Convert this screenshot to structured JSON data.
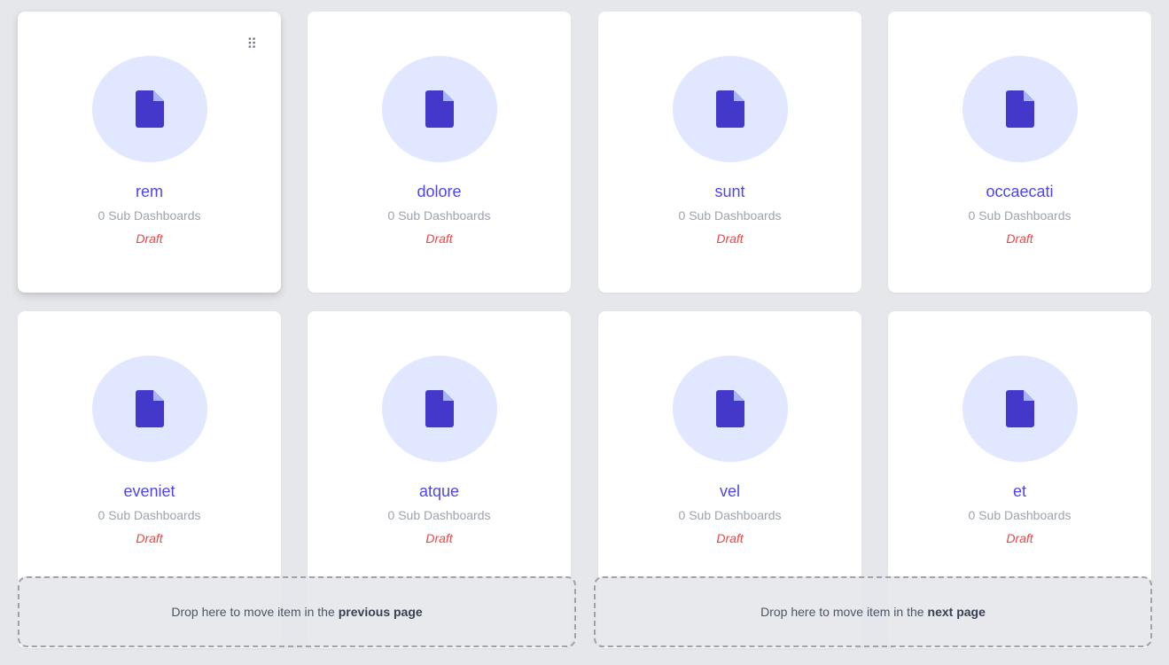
{
  "cards": [
    {
      "title": "rem",
      "subtitle": "0 Sub Dashboards",
      "status": "Draft"
    },
    {
      "title": "dolore",
      "subtitle": "0 Sub Dashboards",
      "status": "Draft"
    },
    {
      "title": "sunt",
      "subtitle": "0 Sub Dashboards",
      "status": "Draft"
    },
    {
      "title": "occaecati",
      "subtitle": "0 Sub Dashboards",
      "status": "Draft"
    },
    {
      "title": "eveniet",
      "subtitle": "0 Sub Dashboards",
      "status": "Draft"
    },
    {
      "title": "atque",
      "subtitle": "0 Sub Dashboards",
      "status": "Draft"
    },
    {
      "title": "vel",
      "subtitle": "0 Sub Dashboards",
      "status": "Draft"
    },
    {
      "title": "et",
      "subtitle": "0 Sub Dashboards",
      "status": "Draft"
    }
  ],
  "drag_handle": "⠿",
  "drop_zones": {
    "previous": {
      "text": "Drop here to move item in the",
      "emphasis": "previous page"
    },
    "next": {
      "text": "Drop here to move item in the",
      "emphasis": "next page"
    }
  },
  "colors": {
    "accent": "#4f46e5",
    "icon_bg": "#e0e7ff",
    "icon": "#4338ca",
    "draft": "#ef4444",
    "muted": "#9ca3af"
  },
  "icons": {
    "card_icon": "document-icon",
    "handle_icon": "drag-handle-icon"
  }
}
